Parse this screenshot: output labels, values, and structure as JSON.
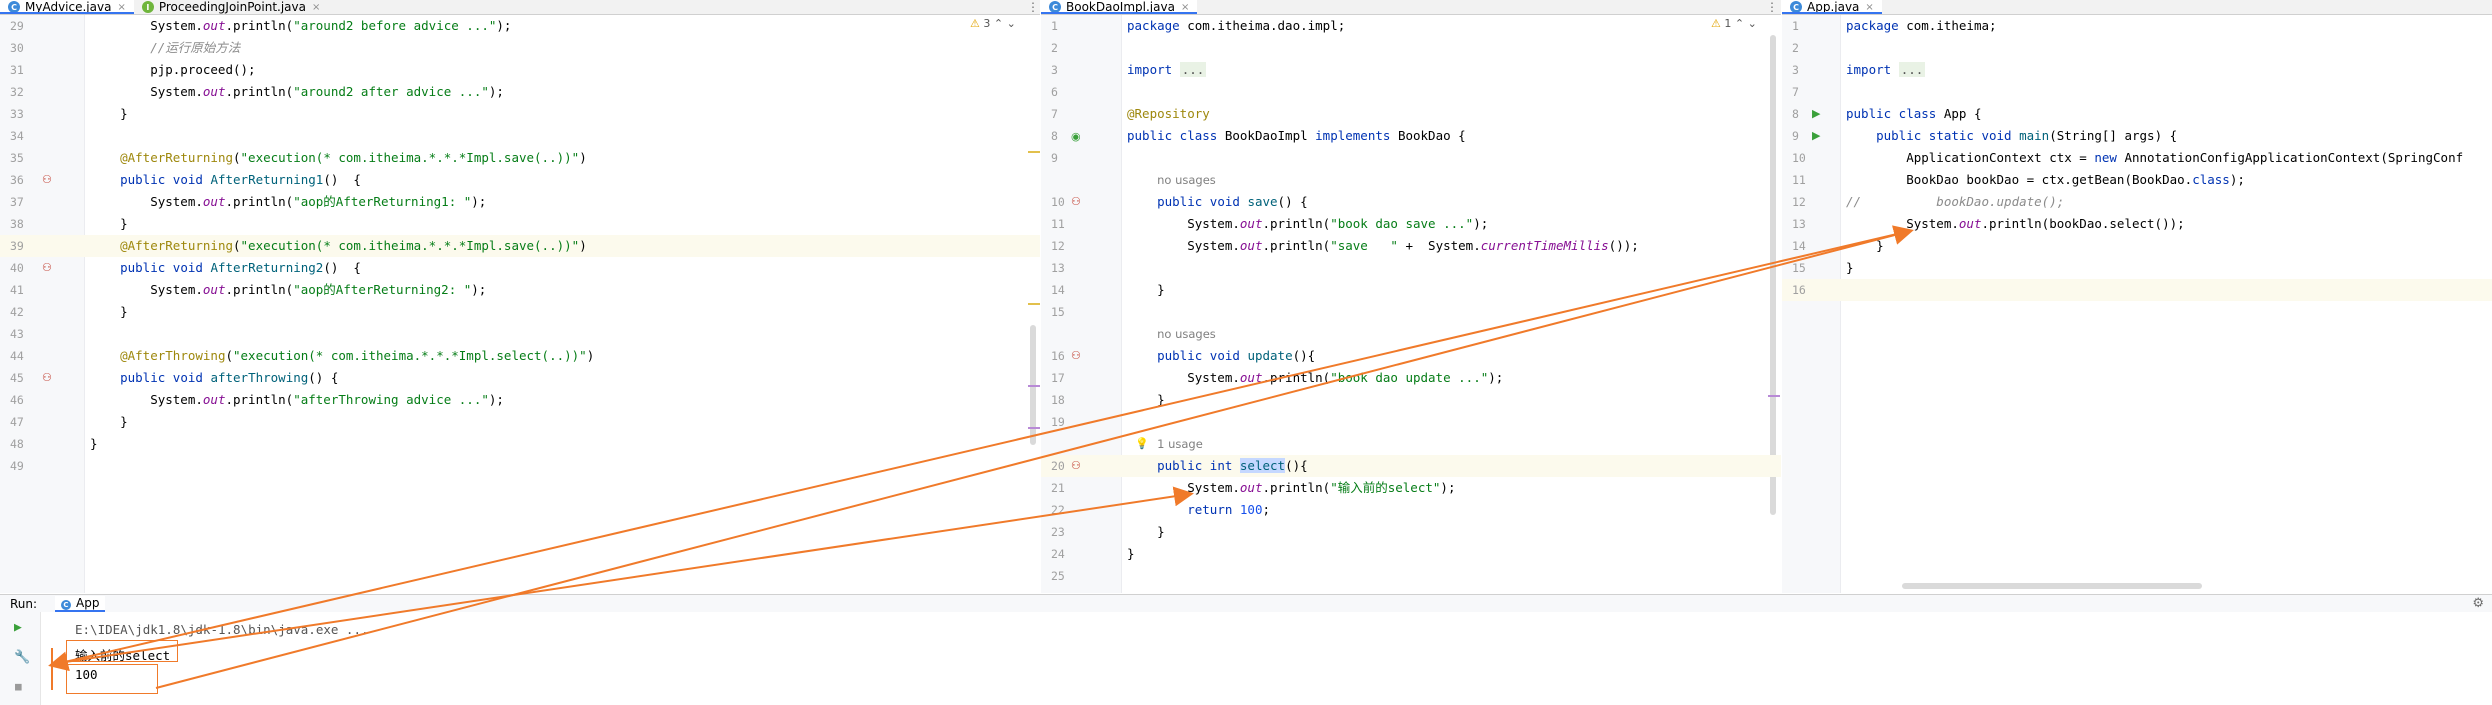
{
  "colors": {
    "arrow": "#f07a2a",
    "accent": "#3574f0",
    "keyword": "#0033b3",
    "string": "#067d17",
    "annotation": "#9e880d"
  },
  "tabs_left": [
    {
      "label": "MyAdvice.java",
      "icon": "class-icon",
      "active": true
    },
    {
      "label": "ProceedingJoinPoint.java",
      "icon": "interface-icon",
      "active": false
    }
  ],
  "tabs_mid": [
    {
      "label": "BookDaoImpl.java",
      "icon": "class-icon",
      "active": true
    }
  ],
  "tabs_right": [
    {
      "label": "App.java",
      "icon": "class-icon",
      "active": true
    }
  ],
  "left_pane": {
    "warnings": "3",
    "lines": [
      {
        "n": "29",
        "html": "        System.<span class=\"st\">out</span>.println(<span class=\"str\">\"around2 before advice ...\"</span>);"
      },
      {
        "n": "30",
        "html": "        <span class=\"cmt\">//运行原始方法</span>"
      },
      {
        "n": "31",
        "html": "        pjp.proceed();"
      },
      {
        "n": "32",
        "html": "        System.<span class=\"st\">out</span>.println(<span class=\"str\">\"around2 after advice ...\"</span>);"
      },
      {
        "n": "33",
        "html": "    }"
      },
      {
        "n": "34",
        "html": ""
      },
      {
        "n": "35",
        "html": "    <span class=\"ann\">@AfterReturning</span>(<span class=\"str\">\"execution(* com.itheima.*.*.*Impl.save(..))\"</span>)"
      },
      {
        "n": "36",
        "html": "    <span class=\"kw\">public void</span> <span class=\"fn\">AfterReturning1</span>()  {"
      },
      {
        "n": "37",
        "html": "        System.<span class=\"st\">out</span>.println(<span class=\"str\">\"aop的AfterReturning1: \"</span>);"
      },
      {
        "n": "38",
        "html": "    }"
      },
      {
        "n": "39",
        "html": "    <span class=\"ann\">@AfterReturning</span>(<span class=\"str\">\"execution(* com.itheima.*.*.*Impl.save(..))\"</span>)"
      },
      {
        "n": "40",
        "html": "    <span class=\"kw\">public void</span> <span class=\"fn\">AfterReturning2</span>()  {"
      },
      {
        "n": "41",
        "html": "        System.<span class=\"st\">out</span>.println(<span class=\"str\">\"aop的AfterReturning2: \"</span>);"
      },
      {
        "n": "42",
        "html": "    }"
      },
      {
        "n": "43",
        "html": ""
      },
      {
        "n": "44",
        "html": "    <span class=\"ann\">@AfterThrowing</span>(<span class=\"str\">\"execution(* com.itheima.*.*.*Impl.select(..))\"</span>)"
      },
      {
        "n": "45",
        "html": "    <span class=\"kw\">public void</span> <span class=\"fn\">afterThrowing</span>() {"
      },
      {
        "n": "46",
        "html": "        System.<span class=\"st\">out</span>.println(<span class=\"str\">\"afterThrowing advice ...\"</span>);"
      },
      {
        "n": "47",
        "html": "    }"
      },
      {
        "n": "48",
        "html": "}"
      },
      {
        "n": "49",
        "html": ""
      }
    ]
  },
  "mid_pane": {
    "warnings": "1",
    "lines": [
      {
        "n": "1",
        "html": "<span class=\"kw\">package</span> com.itheima.dao.impl;"
      },
      {
        "n": "2",
        "html": ""
      },
      {
        "n": "3",
        "html": "<span class=\"kw\">import</span> <span class=\"fold\">...</span>"
      },
      {
        "n": "6",
        "html": ""
      },
      {
        "n": "7",
        "html": "<span class=\"ann\">@Repository</span>"
      },
      {
        "n": "8",
        "html": "<span class=\"kw\">public class</span> BookDaoImpl <span class=\"kw\">implements</span> BookDao {"
      },
      {
        "n": "9",
        "html": ""
      },
      {
        "n": "",
        "html": "    <span class=\"hint\">no usages</span>"
      },
      {
        "n": "10",
        "html": "    <span class=\"kw\">public void</span> <span class=\"fn\">save</span>() {"
      },
      {
        "n": "11",
        "html": "        System.<span class=\"st\">out</span>.println(<span class=\"str\">\"book dao save ...\"</span>);"
      },
      {
        "n": "12",
        "html": "        System.<span class=\"st\">out</span>.println(<span class=\"str\">\"save   \"</span> +  System.<span class=\"st\">currentTimeMillis</span>());"
      },
      {
        "n": "13",
        "html": ""
      },
      {
        "n": "14",
        "html": "    }"
      },
      {
        "n": "15",
        "html": ""
      },
      {
        "n": "",
        "html": "    <span class=\"hint\">no usages</span>"
      },
      {
        "n": "16",
        "html": "    <span class=\"kw\">public void</span> <span class=\"fn\">update</span>(){"
      },
      {
        "n": "17",
        "html": "        System.<span class=\"st\">out</span>.println(<span class=\"str\">\"book dao update ...\"</span>);"
      },
      {
        "n": "18",
        "html": "    }"
      },
      {
        "n": "19",
        "html": ""
      },
      {
        "n": "",
        "html": "    <span class=\"hint\">1 usage</span>"
      },
      {
        "n": "20",
        "html": "    <span class=\"kw\">public int</span> <span class=\"fn sel\">select</span>(){"
      },
      {
        "n": "21",
        "html": "        System.<span class=\"st\">out</span>.println(<span class=\"str\">\"输入前的select\"</span>);"
      },
      {
        "n": "22",
        "html": "        <span class=\"kw\">return</span> <span class=\"num\">100</span>;"
      },
      {
        "n": "23",
        "html": "    }"
      },
      {
        "n": "24",
        "html": "}"
      },
      {
        "n": "25",
        "html": ""
      }
    ]
  },
  "right_pane": {
    "lines": [
      {
        "n": "1",
        "html": "<span class=\"kw\">package</span> com.itheima;"
      },
      {
        "n": "2",
        "html": ""
      },
      {
        "n": "3",
        "html": "<span class=\"kw\">import</span> <span class=\"fold\">...</span>"
      },
      {
        "n": "7",
        "html": ""
      },
      {
        "n": "8",
        "html": "<span class=\"kw\">public class</span> App {"
      },
      {
        "n": "9",
        "html": "    <span class=\"kw\">public static void</span> <span class=\"fn\">main</span>(String[] args) {"
      },
      {
        "n": "10",
        "html": "        ApplicationContext ctx = <span class=\"kw\">new</span> AnnotationConfigApplicationContext(SpringConf"
      },
      {
        "n": "11",
        "html": "        BookDao bookDao = ctx.getBean(BookDao.<span class=\"kw\">class</span>);"
      },
      {
        "n": "12",
        "html": "<span class=\"cmt\">//          bookDao.update();</span>"
      },
      {
        "n": "13",
        "html": "        System.<span class=\"st\">out</span>.println(bookDao.select());"
      },
      {
        "n": "14",
        "html": "    }"
      },
      {
        "n": "15",
        "html": "}"
      },
      {
        "n": "16",
        "html": ""
      }
    ]
  },
  "run": {
    "label": "Run:",
    "tab": "App",
    "console_lines": [
      "E:\\IDEA\\jdk1.8\\jdk-1.8\\bin\\java.exe ...",
      "输入前的select",
      "100"
    ]
  }
}
